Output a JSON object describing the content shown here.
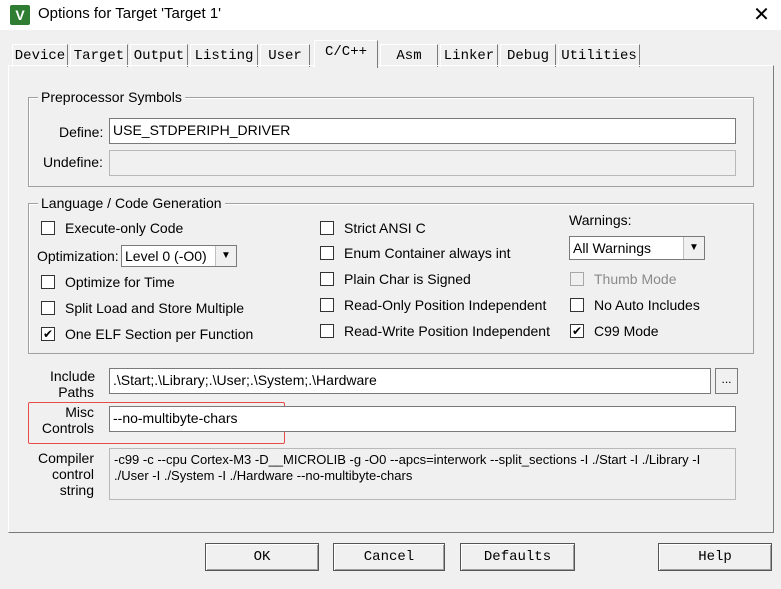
{
  "window": {
    "title": "Options for Target 'Target 1'"
  },
  "tabs": [
    "Device",
    "Target",
    "Output",
    "Listing",
    "User",
    "C/C++",
    "Asm",
    "Linker",
    "Debug",
    "Utilities"
  ],
  "preprocessor": {
    "title": "Preprocessor Symbols",
    "define_label": "Define:",
    "define_value": "USE_STDPERIPH_DRIVER",
    "undefine_label": "Undefine:",
    "undefine_value": ""
  },
  "codegen": {
    "title": "Language / Code Generation",
    "execute_only": {
      "label": "Execute-only Code",
      "checked": false
    },
    "optimization_label": "Optimization:",
    "optimization_value": "Level 0 (-O0)",
    "optimize_time": {
      "label": "Optimize for Time",
      "checked": false
    },
    "split_load": {
      "label": "Split Load and Store Multiple",
      "checked": false
    },
    "one_elf": {
      "label": "One ELF Section per Function",
      "checked": true
    },
    "strict_ansi": {
      "label": "Strict ANSI C",
      "checked": false
    },
    "enum_container": {
      "label": "Enum Container always int",
      "checked": false
    },
    "plain_char": {
      "label": "Plain Char is Signed",
      "checked": false
    },
    "ro_position": {
      "label": "Read-Only Position Independent",
      "checked": false
    },
    "rw_position": {
      "label": "Read-Write Position Independent",
      "checked": false
    },
    "warnings_label": "Warnings:",
    "warnings_value": "All Warnings",
    "thumb_mode": {
      "label": "Thumb Mode",
      "checked": false
    },
    "no_auto_includes": {
      "label": "No Auto Includes",
      "checked": false
    },
    "c99_mode": {
      "label": "C99 Mode",
      "checked": true
    }
  },
  "include_paths": {
    "label_line1": "Include",
    "label_line2": "Paths",
    "value": ".\\Start;.\\Library;.\\User;.\\System;.\\Hardware",
    "browse_label": "..."
  },
  "misc_controls": {
    "label_line1": "Misc",
    "label_line2": "Controls",
    "value": "--no-multibyte-chars"
  },
  "compiler_control": {
    "label_line1": "Compiler",
    "label_line2": "control",
    "label_line3": "string",
    "line1": "-c99 -c --cpu Cortex-M3 -D__MICROLIB -g -O0 --apcs=interwork --split_sections -I ./Start -I ./Library -I",
    "line2": "./User -I ./System -I ./Hardware --no-multibyte-chars"
  },
  "buttons": {
    "ok": "OK",
    "cancel": "Cancel",
    "defaults": "Defaults",
    "help": "Help"
  },
  "colors": {
    "highlight_box": "#e84a4a",
    "app_icon": "#2e7d32"
  }
}
